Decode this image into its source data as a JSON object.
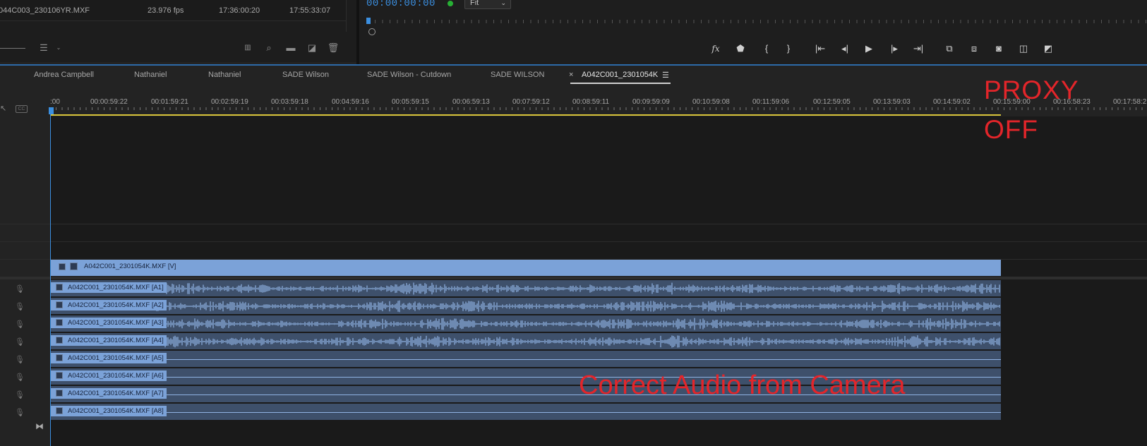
{
  "project": {
    "row": {
      "name": "044C003_230106YR.MXF",
      "fps": "23.976 fps",
      "start": "17:36:00:20",
      "end": "17:55:33:07"
    }
  },
  "program_monitor": {
    "timecode": "00:00:00:00",
    "zoom": "Fit",
    "controls": [
      "fx",
      "marker",
      "in",
      "out",
      "go-to-in",
      "step-back",
      "play",
      "step-forward",
      "go-to-out",
      "lift",
      "extract",
      "export-frame",
      "compare",
      "overlay"
    ]
  },
  "tabs": [
    {
      "label": "Andrea Campbell"
    },
    {
      "label": "Nathaniel"
    },
    {
      "label": "Nathaniel"
    },
    {
      "label": "SADE Wilson"
    },
    {
      "label": "SADE Wilson - Cutdown"
    },
    {
      "label": "SADE WILSON"
    },
    {
      "label": "A042C001_2301054K",
      "active": true,
      "close": "×",
      "menu": "☰"
    }
  ],
  "ruler": {
    "ticks": [
      "00:00",
      "00:00:59:22",
      "00:01:59:21",
      "00:02:59:19",
      "00:03:59:18",
      "00:04:59:16",
      "00:05:59:15",
      "00:06:59:13",
      "00:07:59:12",
      "00:08:59:11",
      "00:09:59:09",
      "00:10:59:08",
      "00:11:59:06",
      "00:12:59:05",
      "00:13:59:03",
      "00:14:59:02",
      "00:15:59:00",
      "00:16:58:23",
      "00:17:58:2"
    ],
    "first_tick_visible": ":00"
  },
  "header": {
    "cc_badge": "CC"
  },
  "video_clip": {
    "name": "A042C001_2301054K.MXF [V]"
  },
  "audio_clips": [
    {
      "name": "A042C001_2301054K.MXF [A1]",
      "has_waveform": true
    },
    {
      "name": "A042C001_2301054K.MXF [A2]",
      "has_waveform": true
    },
    {
      "name": "A042C001_2301054K.MXF [A3]",
      "has_waveform": true
    },
    {
      "name": "A042C001_2301054K.MXF [A4]",
      "has_waveform": true
    },
    {
      "name": "A042C001_2301054K.MXF [A5]",
      "has_waveform": false
    },
    {
      "name": "A042C001_2301054K.MXF [A6]",
      "has_waveform": false
    },
    {
      "name": "A042C001_2301054K.MXF [A7]",
      "has_waveform": false
    },
    {
      "name": "A042C001_2301054K.MXF [A8]",
      "has_waveform": false
    }
  ],
  "annotations": {
    "proxy_line1": "PROXY",
    "proxy_line2": "OFF",
    "audio_note": "Correct Audio from Camera"
  },
  "colors": {
    "accent": "#3b8fe0",
    "annotation": "#e3252a",
    "clip": "#7ba2d8",
    "audio_track": "#3e506b",
    "work_bar": "#d8c43a"
  }
}
